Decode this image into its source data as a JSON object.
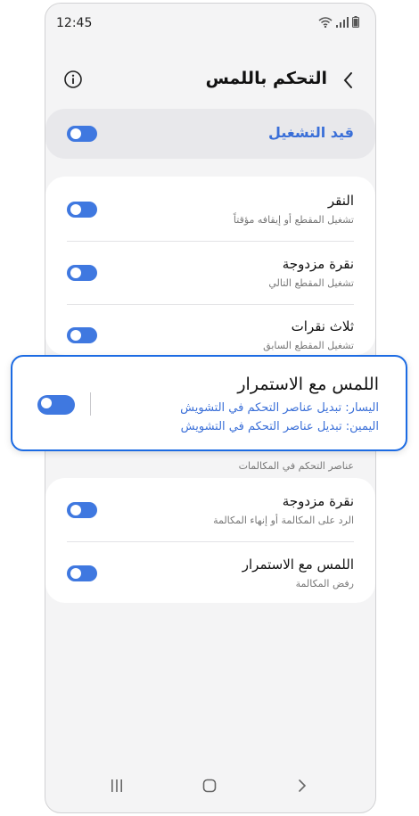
{
  "status_bar": {
    "time": "12:45"
  },
  "header": {
    "title": "التحكم باللمس"
  },
  "master": {
    "label": "قيد التشغيل",
    "on": true
  },
  "media_items": [
    {
      "title": "النقر",
      "subtitle": "تشغيل المقطع أو إيقافه مؤقتاً",
      "on": true
    },
    {
      "title": "نقرة مزدوجة",
      "subtitle": "تشغيل المقطع التالي",
      "on": true
    },
    {
      "title": "ثلاث نقرات",
      "subtitle": "تشغيل المقطع السابق",
      "on": true
    }
  ],
  "popup": {
    "title": "اللمس مع الاستمرار",
    "left_line": "اليسار: تبديل عناصر التحكم في التشويش",
    "right_line": "اليمين: تبديل عناصر التحكم في التشويش",
    "on": true
  },
  "calls_section": {
    "title": "عناصر التحكم في المكالمات"
  },
  "call_items": [
    {
      "title": "نقرة مزدوجة",
      "subtitle": "الرد على المكالمة أو إنهاء المكالمة",
      "on": true
    },
    {
      "title": "اللمس مع الاستمرار",
      "subtitle": "رفض المكالمة",
      "on": true
    }
  ],
  "colors": {
    "accent": "#3f78e0",
    "highlight_border": "#1c6be3",
    "link_text": "#3a6fd8"
  }
}
